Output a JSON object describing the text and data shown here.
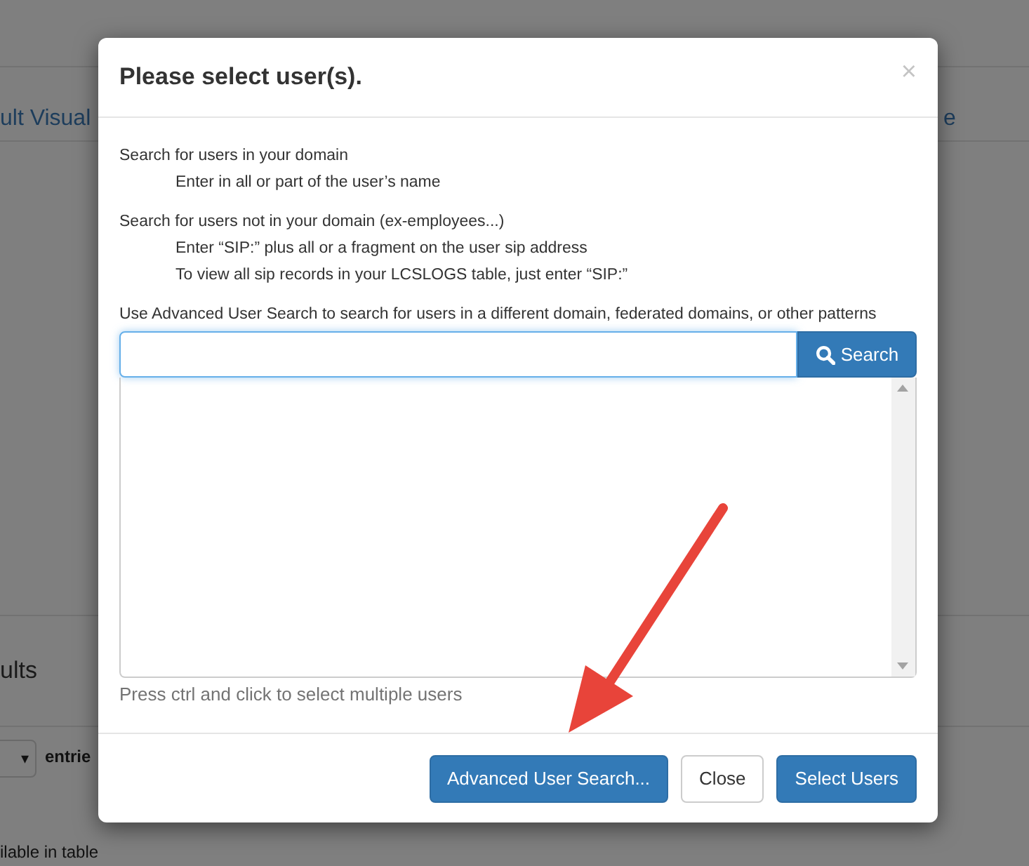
{
  "background_page": {
    "items": [
      {
        "kind": "link",
        "text": "ult Visual"
      },
      {
        "kind": "link-right",
        "text": "e"
      },
      {
        "kind": "heading",
        "text": "ults"
      },
      {
        "kind": "select",
        "text": "▾"
      },
      {
        "kind": "label",
        "text": "entrie"
      },
      {
        "kind": "note",
        "text": "ilable in table"
      }
    ]
  },
  "dialog": {
    "title": "Please select user(s).",
    "close": "×",
    "instructions": [
      {
        "kind": "heading",
        "text": "Search for users in your domain"
      },
      {
        "kind": "indent",
        "text": "Enter in all or part of the user’s name"
      },
      {
        "kind": "gap-heading",
        "text": "Search for users not in your domain (ex-employees...)"
      },
      {
        "kind": "indent",
        "text": "Enter “SIP:” plus all or a fragment on the user sip address"
      },
      {
        "kind": "indent",
        "text": "To view all sip records in your LCSLOGS table, just enter “SIP:”"
      },
      {
        "kind": "gap-heading",
        "text": "Use Advanced User Search to search for users in a different domain, federated domains, or other patterns"
      }
    ],
    "search": {
      "button": "Search"
    },
    "help": "Press ctrl and click to select multiple users",
    "buttons": [
      {
        "kind": "primary",
        "label": "Advanced User Search..."
      },
      {
        "kind": "default",
        "label": "Close"
      },
      {
        "kind": "primary",
        "label": "Select Users"
      }
    ]
  }
}
